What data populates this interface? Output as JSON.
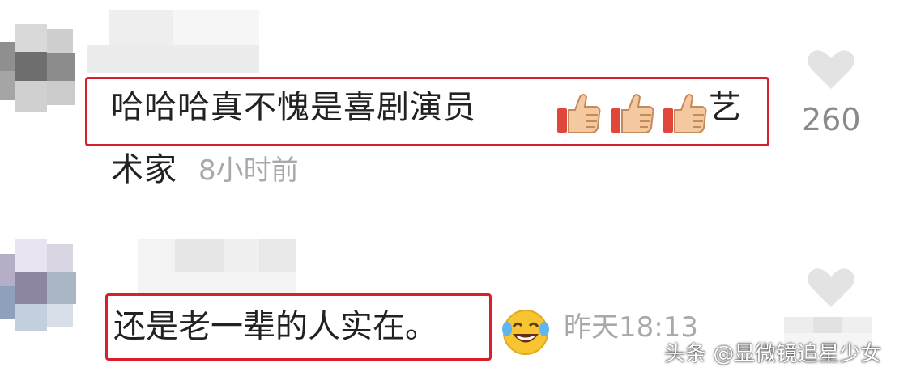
{
  "comments": [
    {
      "text_line1": "哈哈哈真不愧是喜剧演员",
      "emojis": [
        "thumbs-up-icon",
        "thumbs-up-icon",
        "thumbs-up-icon"
      ],
      "text_line1_tail": "艺",
      "text_line2": "术家",
      "time": "8小时前",
      "likes": "260",
      "like_icon": "heart-icon"
    },
    {
      "text": "还是老一辈的人实在。",
      "emoji": "laughing-crying-icon",
      "time": "昨天18:13",
      "like_icon": "heart-icon"
    }
  ],
  "watermark": "头条 @显微镜追星少女",
  "colors": {
    "highlight_border": "#d8202a",
    "text": "#222222",
    "meta_text": "#a9a9a9",
    "icon_gray": "#e3e3e3"
  }
}
